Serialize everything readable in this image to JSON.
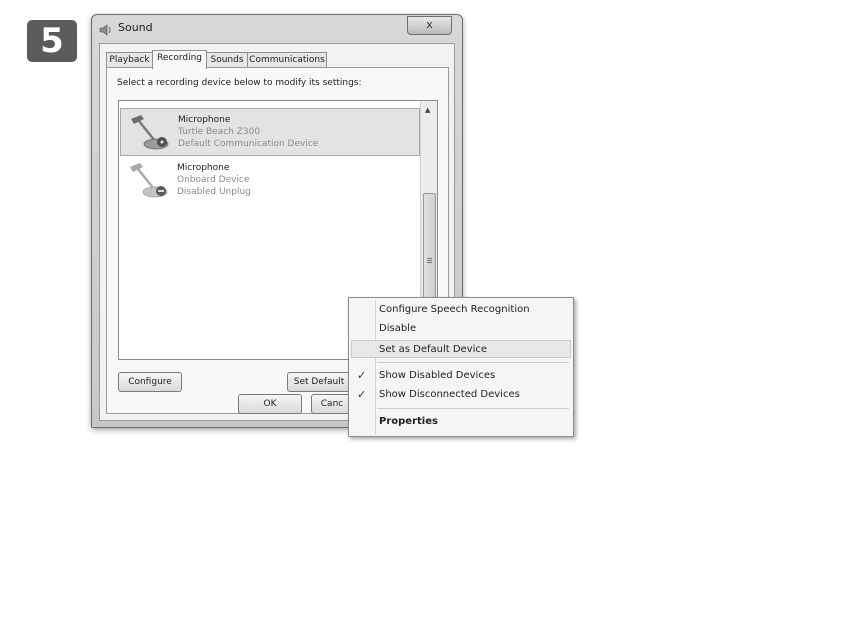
{
  "step": {
    "number": "5"
  },
  "window": {
    "title": "Sound",
    "close_label": "x"
  },
  "tabs": [
    {
      "label": "Playback"
    },
    {
      "label": "Recording"
    },
    {
      "label": "Sounds"
    },
    {
      "label": "Communications"
    }
  ],
  "panel": {
    "instructions": "Select a recording device below to modify its settings:"
  },
  "devices": [
    {
      "name": "Microphone",
      "detail1": "Turtle Beach Z300",
      "detail2": "Default Communication Device",
      "selected": true
    },
    {
      "name": "Microphone",
      "detail1": "Onboard Device",
      "detail2": "Disabled Unplug",
      "selected": false
    }
  ],
  "buttons": {
    "configure": "Configure",
    "set_default": "Set Default",
    "ok": "OK",
    "cancel": "Canc"
  },
  "context_menu": {
    "items": [
      {
        "label": "Configure Speech Recognition"
      },
      {
        "label": "Disable"
      },
      {
        "label": "Set as Default Device"
      },
      {
        "label": "Show Disabled Devices",
        "checked": true
      },
      {
        "label": "Show Disconnected Devices",
        "checked": true
      },
      {
        "label": "Properties"
      }
    ],
    "check_glyph": "✓"
  }
}
